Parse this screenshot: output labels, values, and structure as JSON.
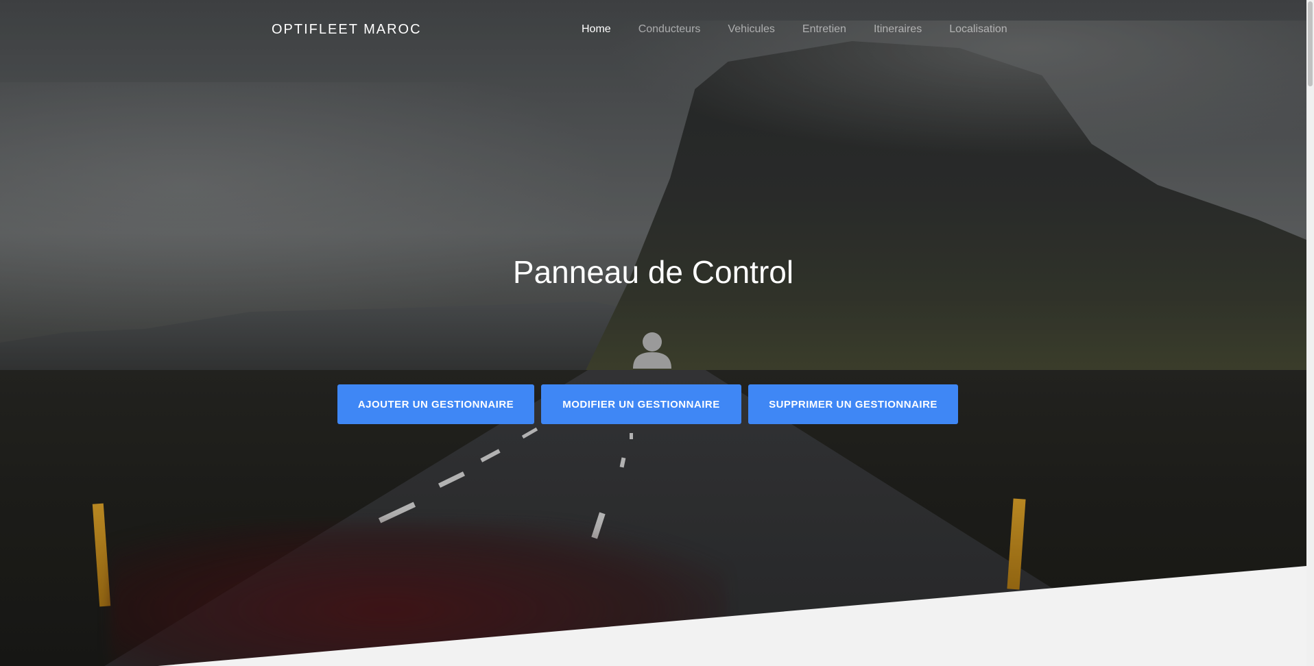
{
  "navbar": {
    "brand": "OPTIFLEET MAROC",
    "links": [
      "Home",
      "Conducteurs",
      "Vehicules",
      "Entretien",
      "Itineraires",
      "Localisation"
    ],
    "active": "Home"
  },
  "hero": {
    "title": "Panneau de Control",
    "icon": "user-icon",
    "buttons": {
      "add": "AJOUTER UN GESTIONNAIRE",
      "edit": "MODIFIER UN GESTIONNAIRE",
      "delete": "SUPPRIMER UN GESTIONNAIRE"
    }
  },
  "colors": {
    "button": "#3f87f5",
    "section_bg": "#f2f2f2"
  }
}
